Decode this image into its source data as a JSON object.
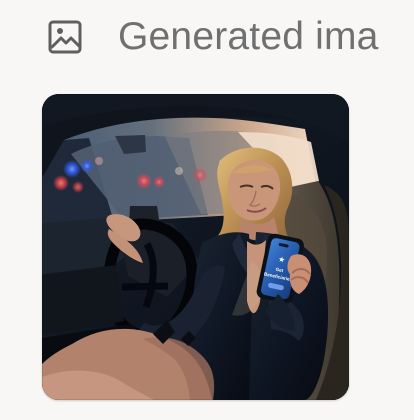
{
  "header": {
    "title": "Generated ima",
    "icon": "image-icon"
  },
  "image": {
    "subject": "generated-image-thumbnail",
    "palette": {
      "interior": "#141923",
      "hair": "#c39a5b",
      "skin": "#c9967b",
      "blazer": "#101827",
      "phone": "#2f67b2",
      "police_blue": "#3a67ff",
      "police_red": "#e54850"
    }
  }
}
